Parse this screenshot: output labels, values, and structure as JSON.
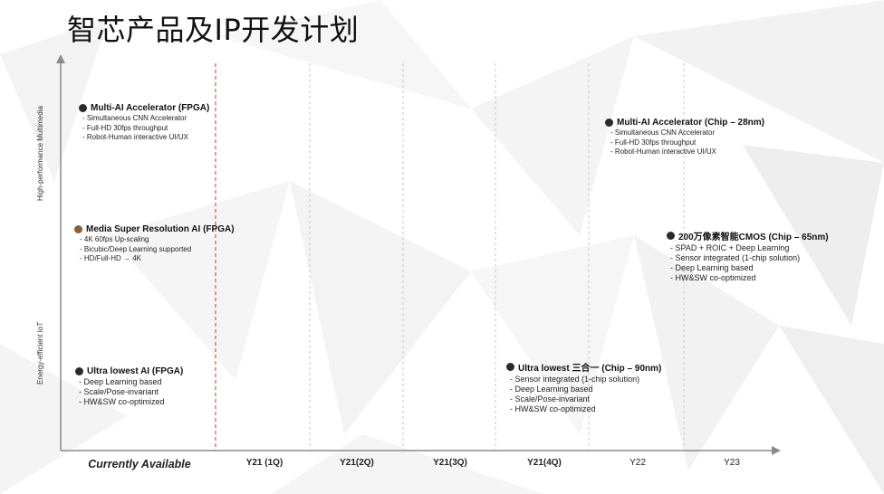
{
  "page": {
    "title": "智芯产品及IP开发计划"
  },
  "axes": {
    "y_top": "High-performance Multimedia",
    "y_bottom": "Energy-efficient IoT",
    "x_labels": [
      "Currently Available",
      "Y21 (1Q)",
      "Y21(2Q)",
      "Y21(3Q)",
      "Y21(4Q)",
      "Y22",
      "Y23"
    ]
  },
  "items": [
    {
      "title": "Multi-AI Accelerator (FPGA)",
      "lines": [
        "- Simultaneous CNN Accelerator",
        "- Full-HD 30fps throughput",
        "- Robot-Human interactive UI/UX"
      ]
    },
    {
      "title": "Media Super Resolution AI (FPGA)",
      "lines": [
        "- 4K 60fps Up-scaling",
        "- Bicubic/Deep Learning supported",
        "- HD/Full-HD → 4K"
      ]
    },
    {
      "title": "Ultra lowest AI  (FPGA)",
      "lines": [
        "- Deep Learning based",
        "- Scale/Pose-invariant",
        "- HW&SW co-optimized"
      ]
    },
    {
      "title": "Multi-AI Accelerator (Chip – 28nm)",
      "lines": [
        "- Simultaneous CNN Accelerator",
        "- Full-HD 30fps throughput",
        "- Robot-Human interactive UI/UX"
      ]
    },
    {
      "title": "200万像素智能CMOS (Chip – 65nm)",
      "lines": [
        "- SPAD + ROIC + Deep Learning",
        "- Sensor integrated (1-chip solution)",
        "- Deep Learning based",
        "- HW&SW co-optimized"
      ]
    },
    {
      "title": "Ultra lowest 三合一 (Chip – 90nm)",
      "lines": [
        "- Sensor integrated (1-chip solution)",
        "- Deep Learning based",
        "- Scale/Pose-invariant",
        "- HW&SW co-optimized"
      ]
    }
  ],
  "colors": {
    "axis": "#8a8a8a",
    "divider": "#bdbdbd",
    "current_line": "#c0392b",
    "dot": "#2a2a2a",
    "dot_media": "#8b5e3c"
  }
}
